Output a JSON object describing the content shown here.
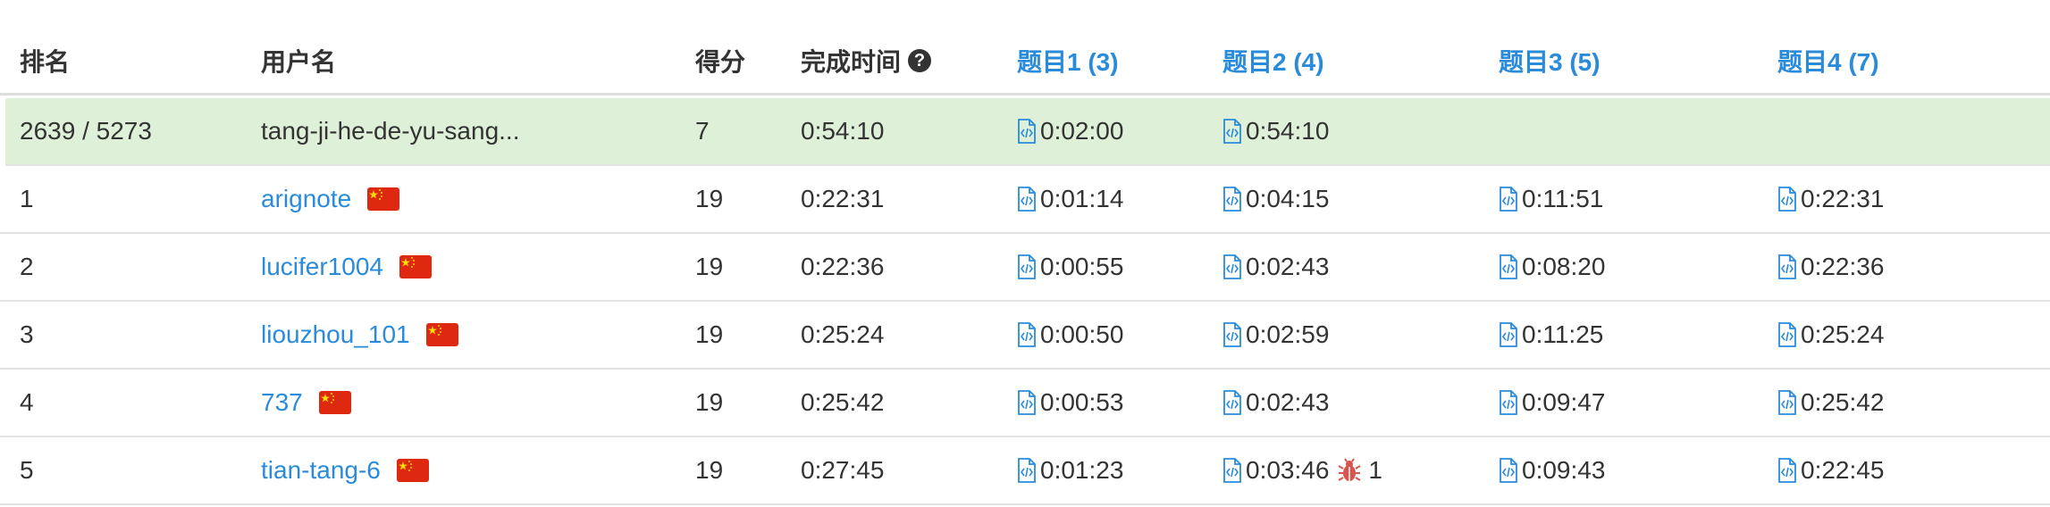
{
  "header": {
    "rank": "排名",
    "username": "用户名",
    "score": "得分",
    "finish_time": "完成时间",
    "problems": [
      "题目1 (3)",
      "题目2 (4)",
      "题目3 (5)",
      "题目4 (7)"
    ]
  },
  "self_row": {
    "rank": "2639 / 5273",
    "username": "tang-ji-he-de-yu-sang...",
    "score": "7",
    "finish_time": "0:54:10",
    "p1": "0:02:00",
    "p2": "0:54:10"
  },
  "rows": [
    {
      "rank": "1",
      "username": "arignote",
      "score": "19",
      "finish_time": "0:22:31",
      "p1": "0:01:14",
      "p2": "0:04:15",
      "p3": "0:11:51",
      "p4": "0:22:31",
      "flag": "cn-flag"
    },
    {
      "rank": "2",
      "username": "lucifer1004",
      "score": "19",
      "finish_time": "0:22:36",
      "p1": "0:00:55",
      "p2": "0:02:43",
      "p3": "0:08:20",
      "p4": "0:22:36",
      "flag": "cn-flag"
    },
    {
      "rank": "3",
      "username": "liouzhou_101",
      "score": "19",
      "finish_time": "0:25:24",
      "p1": "0:00:50",
      "p2": "0:02:59",
      "p3": "0:11:25",
      "p4": "0:25:24",
      "flag": "cn-flag"
    },
    {
      "rank": "4",
      "username": "737",
      "score": "19",
      "finish_time": "0:25:42",
      "p1": "0:00:53",
      "p2": "0:02:43",
      "p3": "0:09:47",
      "p4": "0:25:42",
      "flag": "cn-flag"
    },
    {
      "rank": "5",
      "username": "tian-tang-6",
      "score": "19",
      "finish_time": "0:27:45",
      "p1": "0:01:23",
      "p2": "0:03:46",
      "p2_bugs": "1",
      "p3": "0:09:43",
      "p4": "0:22:45",
      "flag": "cn-flag"
    }
  ],
  "icons": {
    "help": "question-circle-icon",
    "solution": "code-file-icon",
    "wrong_answer": "bug-icon",
    "flag": "china-flag-icon"
  },
  "colors": {
    "link": "#2a8bdb",
    "self_row_bg": "#dff0d8",
    "flag_red": "#de2910",
    "flag_star": "#ffde00",
    "bug": "#d9534f"
  }
}
